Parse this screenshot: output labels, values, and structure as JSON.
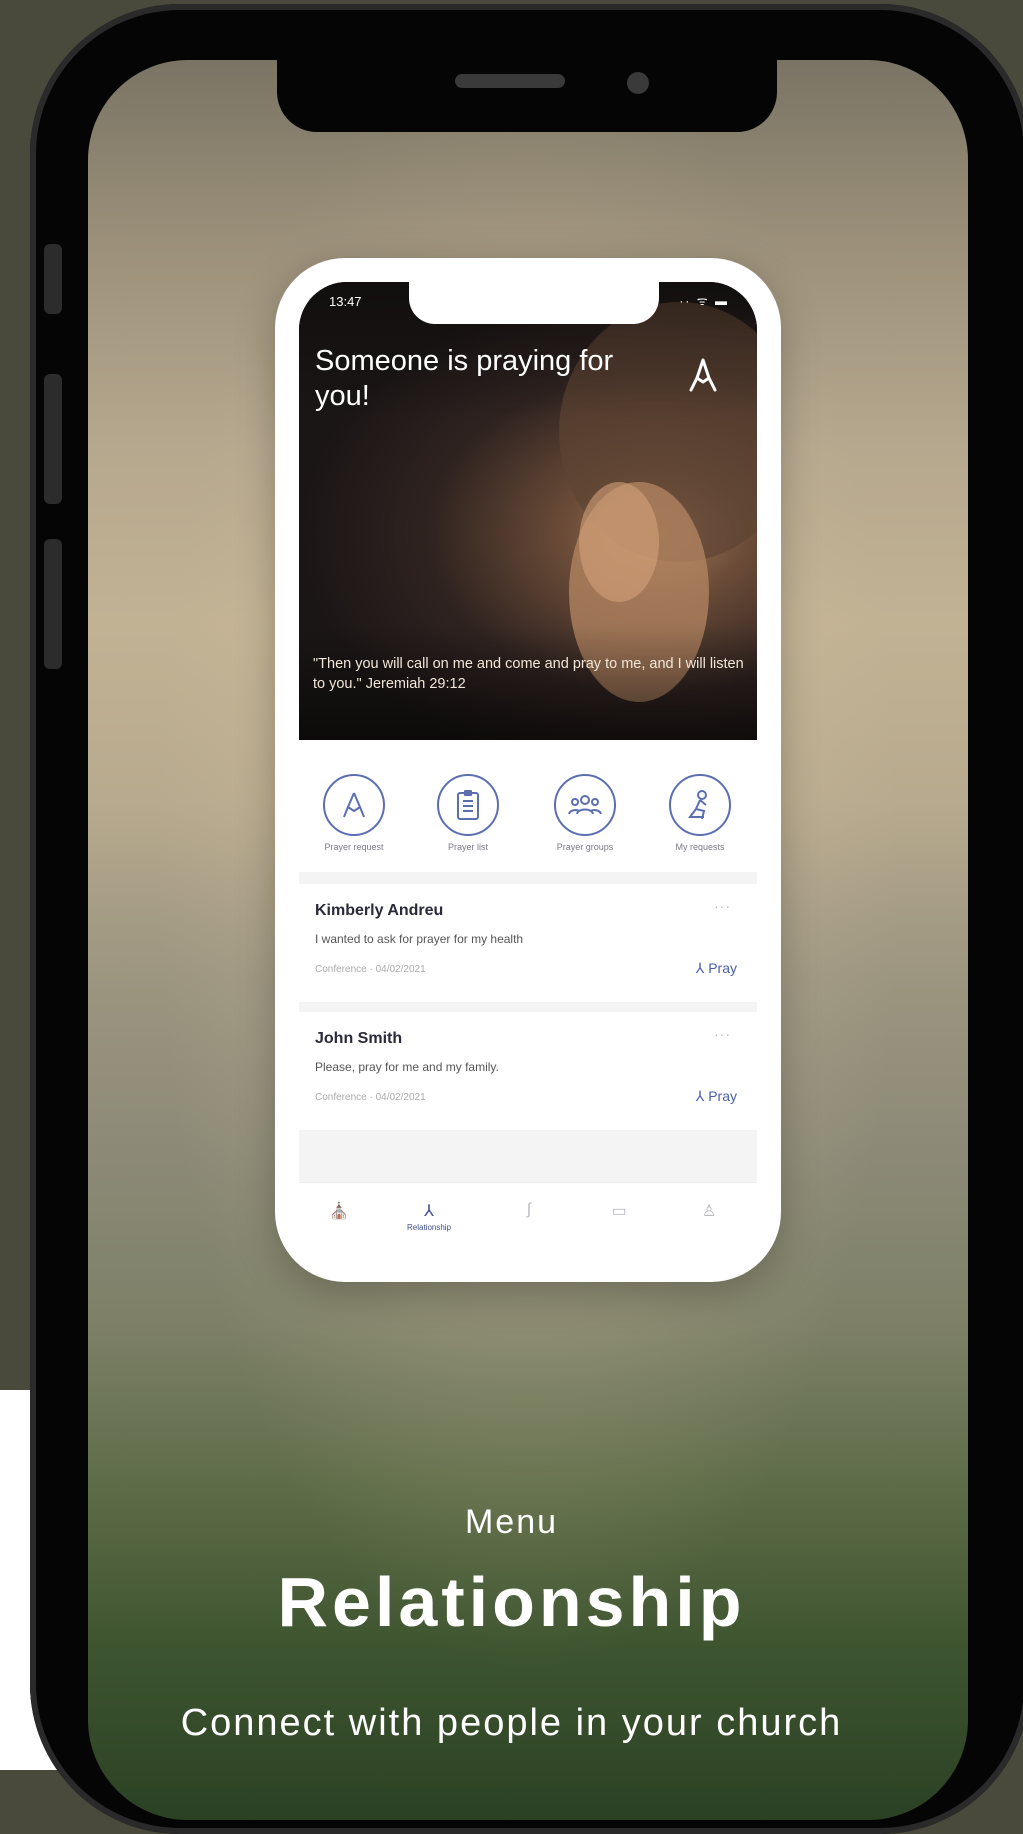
{
  "mockup": {
    "status_time": "13:47",
    "status_icons": "·· ᯤ ▬",
    "hero_title": "Someone is praying for you!",
    "hero_quote": "\"Then you will call on me and come and pray to me, and I will listen to you.\" Jeremiah 29:12",
    "actions": [
      {
        "label": "Prayer request",
        "icon": "praying-hands-icon"
      },
      {
        "label": "Prayer list",
        "icon": "clipboard-icon"
      },
      {
        "label": "Prayer groups",
        "icon": "group-icon"
      },
      {
        "label": "My requests",
        "icon": "kneeling-person-icon"
      }
    ],
    "requests": [
      {
        "name": "Kimberly Andreu",
        "message": "I wanted to ask for prayer for my health",
        "meta": "Conference · 04/02/2021",
        "more": "···",
        "pray_label": "Pray"
      },
      {
        "name": "John Smith",
        "message": "Please, pray for me and my family.",
        "meta": "Conference · 04/02/2021",
        "more": "···",
        "pray_label": "Pray"
      }
    ],
    "tabs": [
      {
        "icon": "church-icon",
        "label": ""
      },
      {
        "icon": "praying-hands-icon",
        "label": "Relationship"
      },
      {
        "icon": "signature-icon",
        "label": ""
      },
      {
        "icon": "bible-icon",
        "label": ""
      },
      {
        "icon": "profile-icon",
        "label": ""
      }
    ]
  },
  "caption": {
    "subtitle": "Menu",
    "title": "Relationship",
    "description": "Connect with people in your church"
  },
  "colors": {
    "accent": "#4b5fa8",
    "device": "#050505",
    "backdrop": "#4a4a3c"
  }
}
